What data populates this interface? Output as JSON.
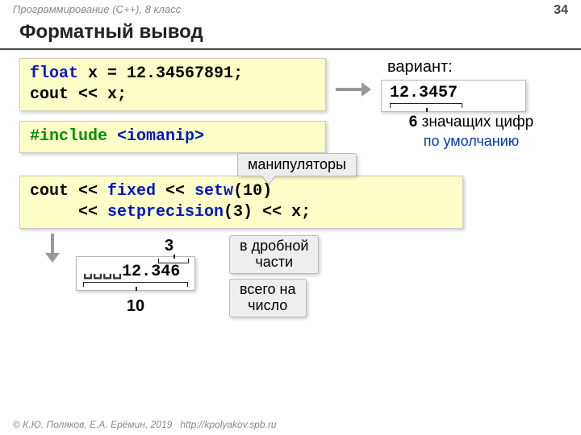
{
  "header": {
    "course": "Программирование (С++), 8 класс",
    "page": "34"
  },
  "title": "Форматный вывод",
  "code1": {
    "l1a": "float",
    "l1b": " x = ",
    "l1c": "12.34567891",
    "l1d": ";",
    "l2a": "cout << x;"
  },
  "variant_label": "вариант:",
  "output1": "12.3457",
  "sig": {
    "num": "6",
    "text": " значащих цифр"
  },
  "default_text": "по умолчанию",
  "code2": {
    "a": "#include ",
    "b": "<iomanip>"
  },
  "manip_label": "манипуляторы",
  "code3": {
    "l1": "cout << ",
    "fixed": "fixed",
    "mid1": " << ",
    "setw": "setw",
    "arg1": "(10)",
    "l2pad": "     << ",
    "setp": "setprecision",
    "arg2": "(3)",
    "tail": " << x;"
  },
  "output2": {
    "spaces": "␣␣␣␣",
    "val": "12.",
    "frac": "346"
  },
  "anno": {
    "three": "3",
    "ten": "10",
    "frac_part": "в дробной\nчасти",
    "total": "всего на\nчисло"
  },
  "footer": {
    "copy": "© К.Ю. Поляков, Е.А. Ерёмин, 2019",
    "url": "http://kpolyakov.spb.ru"
  }
}
